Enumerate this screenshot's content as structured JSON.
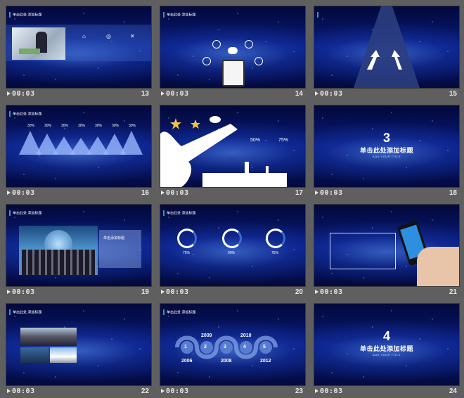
{
  "slides": [
    {
      "num": "13",
      "time": "00:03",
      "header": "单击此处 添加标题"
    },
    {
      "num": "14",
      "time": "00:03",
      "header": "单击此处 添加标题"
    },
    {
      "num": "15",
      "time": "00:03",
      "header": ""
    },
    {
      "num": "16",
      "time": "00:03",
      "header": "单击此处 添加标题",
      "percents": [
        "30%",
        "30%",
        "30%",
        "30%",
        "30%",
        "30%",
        "30%"
      ]
    },
    {
      "num": "17",
      "time": "00:03",
      "header": "",
      "stats": [
        "50%",
        "75%"
      ]
    },
    {
      "num": "18",
      "time": "00:03",
      "big_num": "3",
      "big_title": "单击此处添加标题",
      "sub": "ADD YOUR TITLE"
    },
    {
      "num": "19",
      "time": "00:03",
      "header": "单击此处 添加标题",
      "box_title": "单击添加标题"
    },
    {
      "num": "20",
      "time": "00:03",
      "header": "单击此处 添加标题",
      "percents": [
        "75%",
        "60%",
        "75%"
      ]
    },
    {
      "num": "21",
      "time": "00:03",
      "header": ""
    },
    {
      "num": "22",
      "time": "00:03",
      "header": "单击此处 添加标题"
    },
    {
      "num": "23",
      "time": "00:03",
      "header": "单击此处 添加标题",
      "years_top": [
        "2009",
        "2010"
      ],
      "years_bottom": [
        "2006",
        "2008",
        "2012"
      ],
      "steps": [
        "1",
        "2",
        "3",
        "4",
        "5"
      ]
    },
    {
      "num": "24",
      "time": "00:03",
      "big_num": "4",
      "big_title": "单击此处添加标题",
      "sub": "ADD YOUR TITLE"
    }
  ],
  "colors": {
    "accent": "#f0a020",
    "bg": "#5f5f5f",
    "slide_blue": "#081a7a"
  }
}
